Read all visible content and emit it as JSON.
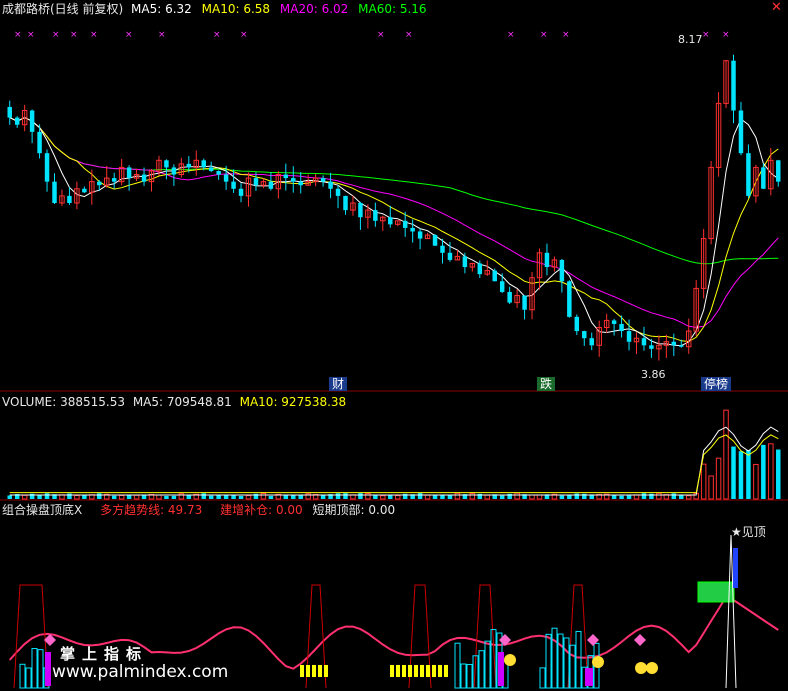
{
  "header": {
    "title": "成都路桥(日线 前复权)",
    "ma5": "MA5: 6.32",
    "ma10": "MA10: 6.58",
    "ma20": "MA20: 6.02",
    "ma60": "MA60: 5.16"
  },
  "price_panel": {
    "high_label": "8.17",
    "low_label": "3.86",
    "event_tags": [
      "财",
      "跌",
      "停榜"
    ]
  },
  "volume_header": {
    "volume": "VOLUME: 388515.53",
    "ma5": "MA5: 709548.81",
    "ma10": "MA10: 927538.38"
  },
  "indicator_header": {
    "name": "组合操盘顶底X",
    "trend": "多方趋势线: 49.73",
    "add": "建增补仓: 0.00",
    "top": "短期顶部: 0.00"
  },
  "indicator_panel": {
    "top_signal": "见顶"
  },
  "watermark": {
    "line1": "掌上指标",
    "line2": "www.palmindex.com"
  },
  "colors": {
    "up": "#ff3030",
    "down": "#00e5ff",
    "ma5": "#ffffff",
    "ma10": "#ffff00",
    "ma20": "#ff00ff",
    "ma60": "#00ff00",
    "trend_line": "#ff3070"
  },
  "chart_data": {
    "type": "candlestick",
    "y_range": [
      3.86,
      8.17
    ],
    "closes": [
      7.2,
      7.1,
      7.3,
      7.0,
      6.7,
      6.3,
      6.0,
      6.1,
      6.0,
      6.2,
      6.15,
      6.3,
      6.25,
      6.35,
      6.3,
      6.5,
      6.35,
      6.4,
      6.3,
      6.45,
      6.6,
      6.5,
      6.4,
      6.55,
      6.5,
      6.6,
      6.5,
      6.45,
      6.4,
      6.3,
      6.2,
      6.1,
      6.35,
      6.25,
      6.3,
      6.2,
      6.4,
      6.35,
      6.3,
      6.25,
      6.3,
      6.35,
      6.3,
      6.2,
      6.1,
      5.9,
      6.0,
      5.8,
      5.9,
      5.75,
      5.8,
      5.7,
      5.75,
      5.65,
      5.6,
      5.5,
      5.55,
      5.4,
      5.3,
      5.2,
      5.25,
      5.1,
      5.15,
      5.0,
      5.05,
      4.9,
      4.75,
      4.6,
      4.7,
      4.5,
      4.95,
      5.3,
      5.1,
      5.2,
      4.9,
      4.4,
      4.2,
      4.1,
      4.0,
      4.25,
      4.35,
      4.3,
      4.2,
      4.05,
      4.1,
      4.0,
      3.95,
      4.0,
      4.05,
      4.0,
      3.98,
      4.2,
      4.8,
      5.5,
      6.5,
      7.4,
      8.0,
      7.3,
      6.7,
      6.1,
      6.5,
      6.2,
      6.6,
      6.3
    ],
    "ma5_label": "MA5",
    "ma10_label": "MA10",
    "ma20_label": "MA20",
    "ma60_label": "MA60"
  }
}
